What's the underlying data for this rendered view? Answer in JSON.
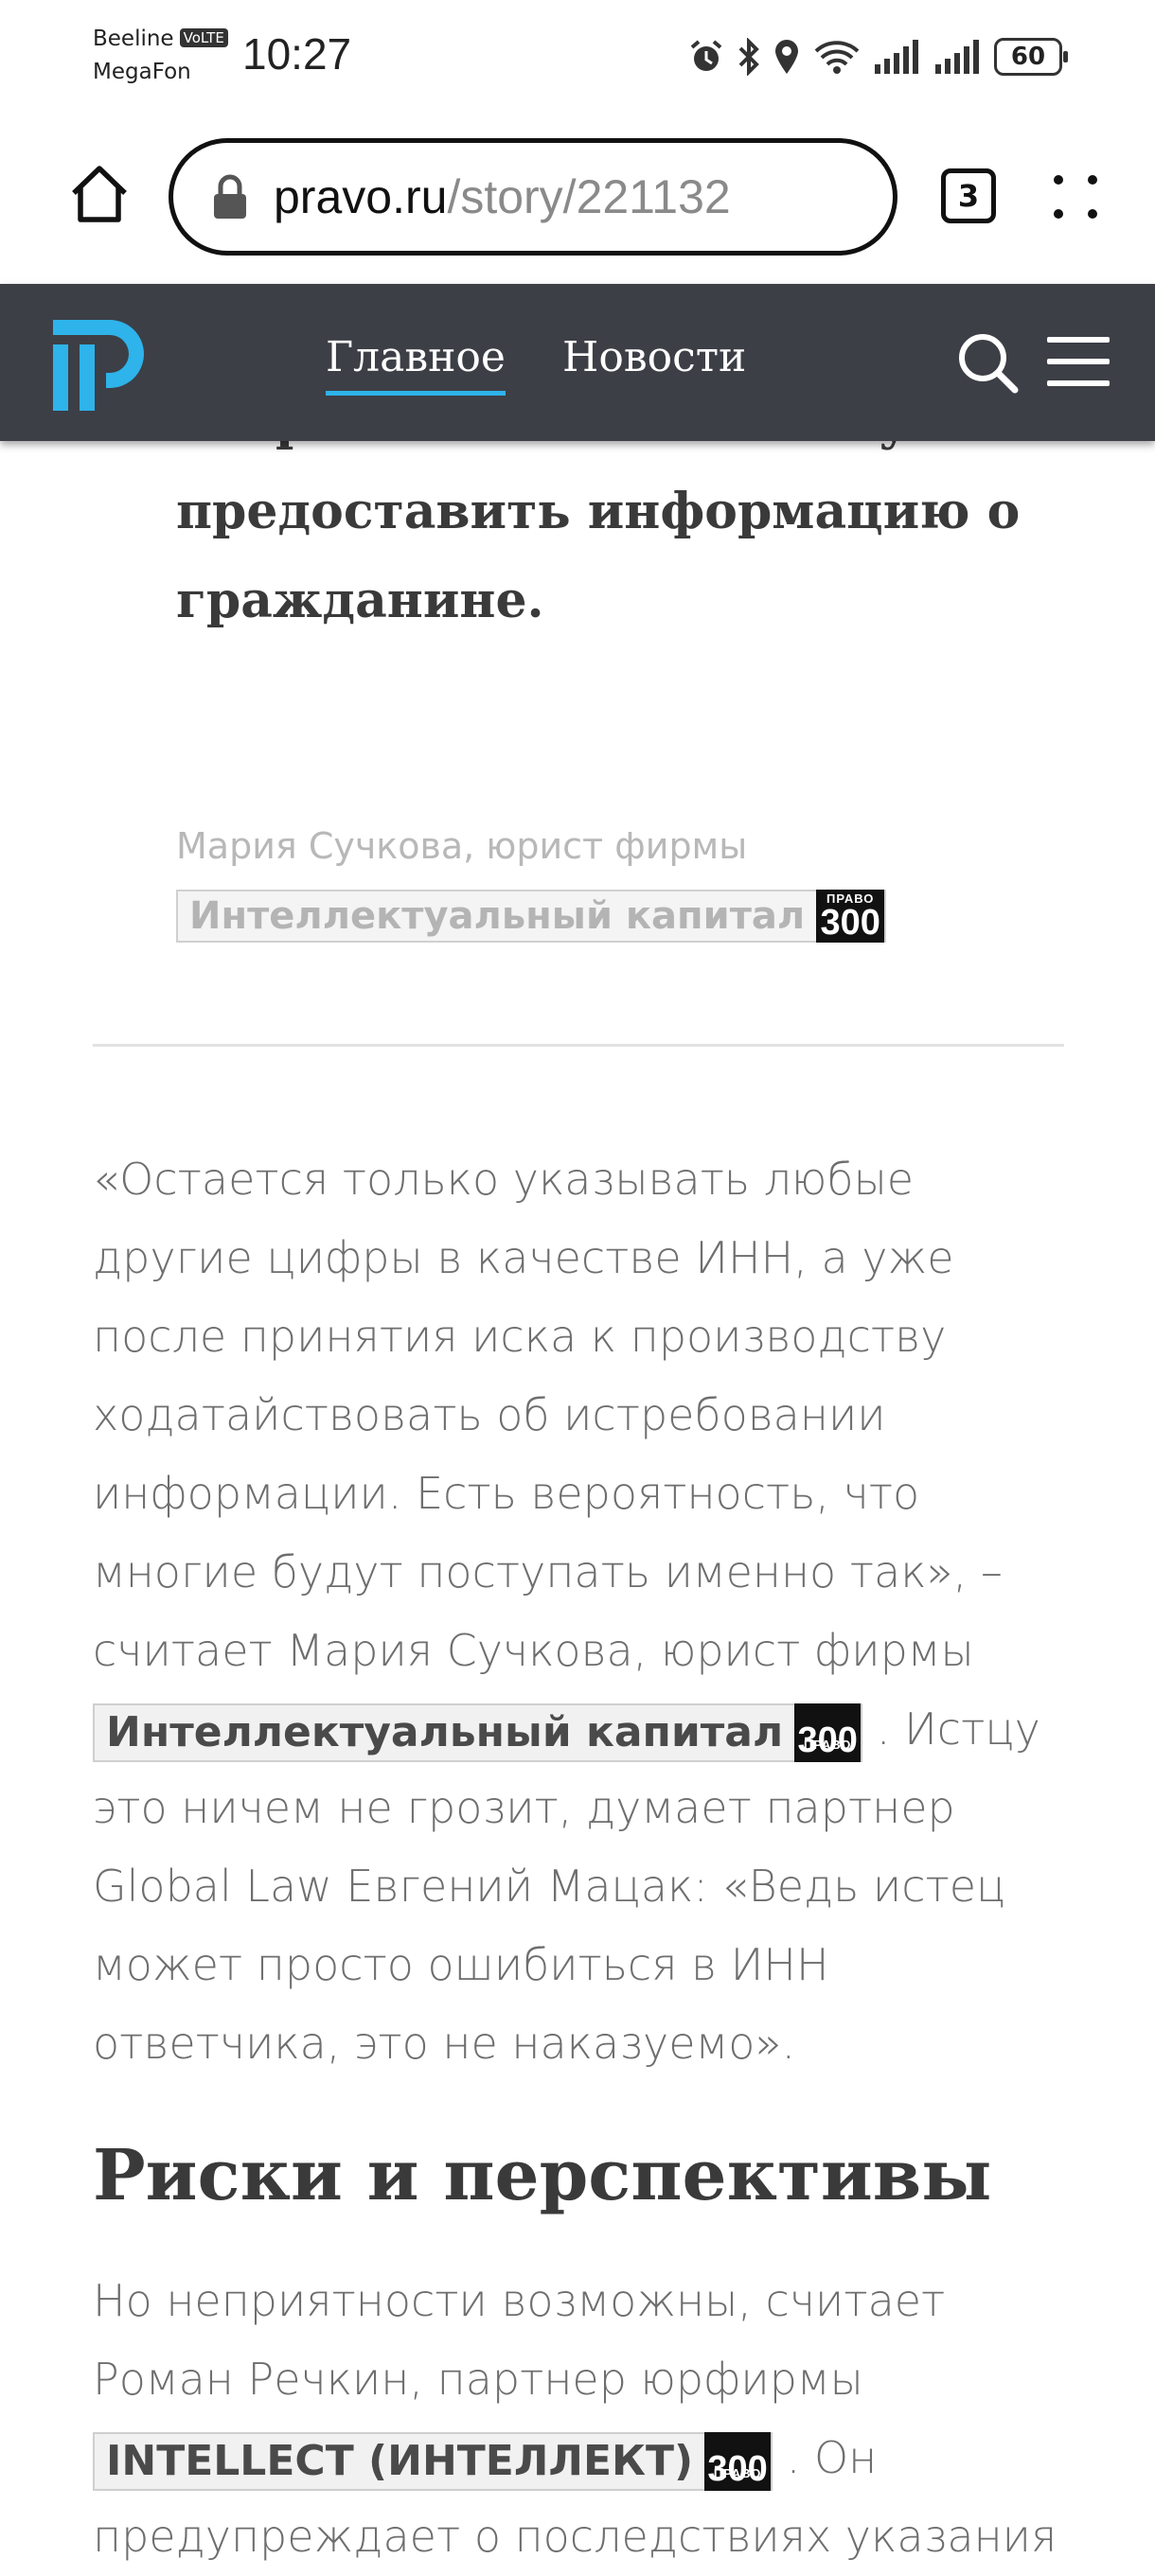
{
  "status_bar": {
    "carrier1": "Beeline",
    "volte": "VoLTE",
    "carrier2": "MegaFon",
    "time": "10:27",
    "battery": "60"
  },
  "browser": {
    "url_domain": "pravo.ru",
    "url_path": "/story/221132",
    "tab_count": "3"
  },
  "site_header": {
    "nav": [
      "Главное",
      "Новости"
    ],
    "active_nav": "Главное",
    "accent": "#2eb3ea",
    "bg": "#3c3f46"
  },
  "article": {
    "quote_lead_lines": [
      "запроса ФНС и ПФР могут",
      "предоставить информацию о",
      "гражданине."
    ],
    "quote_author": "Мария Сучкова, юрист фирмы",
    "quote_firm": "Интеллектуальный капитал",
    "badge_top": "ПРАВО",
    "badge_num": "300",
    "p1_before": "«Остается только указывать любые другие цифры в качестве ИНН, а уже после принятия иска к производству ходатайствовать об истребовании информации. Есть вероятность, что многие будут поступать именно так», – считает Мария Сучкова, юрист фирмы",
    "p1_firm": "Интеллектуальный капитал",
    "p1_after": ". Истцу это ничем не грозит, думает партнер Global Law Евгений Мацак: «Ведь истец может просто ошибиться в ИНН ответчика, это не наказуемо».",
    "heading": "Риски и перспективы",
    "p2_before": "Но неприятности возможны, считает Роман Речкин, партнер юрфирмы",
    "p2_firm": "INTELLECT (ИНТЕЛЛЕКТ)",
    "p2_after": ". Он предупреждает о последствиях указания"
  }
}
